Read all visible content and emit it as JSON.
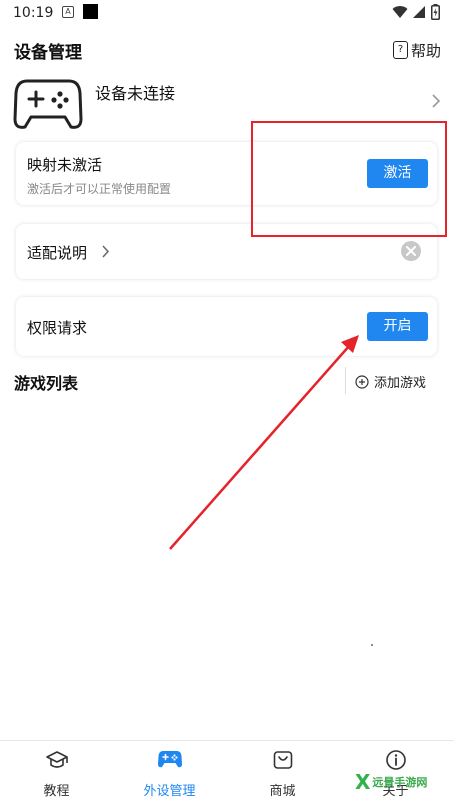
{
  "status_bar": {
    "time": "10:19",
    "a_badge": "A"
  },
  "header": {
    "title": "设备管理",
    "help_label": "帮助",
    "help_glyph": "?"
  },
  "device": {
    "status": "设备未连接",
    "icon": "gamepad-icon"
  },
  "mapping_card": {
    "title": "映射未激活",
    "subtitle": "激活后才可以正常使用配置",
    "button": "激活"
  },
  "adapt_card": {
    "label": "适配说明"
  },
  "permission_card": {
    "label": "权限请求",
    "button": "开启"
  },
  "game_list": {
    "title": "游戏列表",
    "add_label": "添加游戏"
  },
  "bottom_nav": {
    "items": [
      {
        "label": "教程",
        "icon": "graduation-cap-icon"
      },
      {
        "label": "外设管理",
        "icon": "gamepad-icon"
      },
      {
        "label": "商城",
        "icon": "shopping-bag-icon"
      },
      {
        "label": "关于",
        "icon": "info-icon"
      }
    ],
    "active": "外设管理"
  },
  "watermark": {
    "text": "远景手游网"
  },
  "colors": {
    "accent": "#1f87ef",
    "annotation": "#e5232a",
    "watermark": "#2fb34a"
  }
}
